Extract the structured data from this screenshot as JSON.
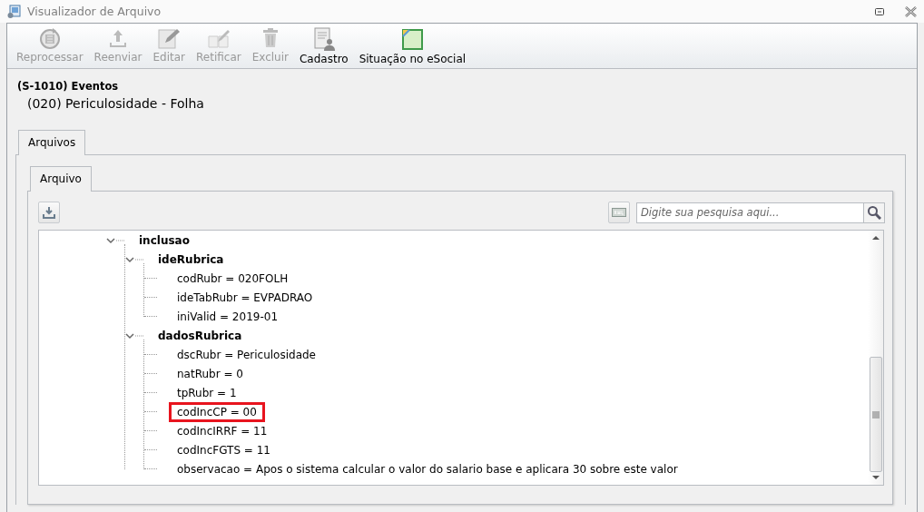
{
  "window": {
    "title": "Visualizador de Arquivo"
  },
  "toolbar": [
    {
      "label": "Reprocessar",
      "disabled": true
    },
    {
      "label": "Reenviar",
      "disabled": true
    },
    {
      "label": "Editar",
      "disabled": true
    },
    {
      "label": "Retificar",
      "disabled": true
    },
    {
      "label": "Excluir",
      "disabled": true
    },
    {
      "label": "Cadastro",
      "disabled": false
    },
    {
      "label": "Situação no eSocial",
      "disabled": false
    }
  ],
  "header": {
    "event": "(S-1010) Eventos",
    "subtitle": "(020) Periculosidade  - Folha"
  },
  "outer_tabs": [
    {
      "label": "Arquivos",
      "selected": true
    }
  ],
  "inner_tabs": [
    {
      "label": "Arquivo",
      "selected": true
    }
  ],
  "search": {
    "placeholder": "Digite sua pesquisa aqui..."
  },
  "tree": [
    {
      "label": "inclusao",
      "expanded": true,
      "children": [
        {
          "label": "ideRubrica",
          "expanded": true,
          "children": [
            {
              "label": "codRubr = 020FOLH",
              "highlighted": false
            },
            {
              "label": "ideTabRubr = EVPADRAO",
              "highlighted": false
            },
            {
              "label": "iniValid = 2019-01",
              "highlighted": false
            }
          ]
        },
        {
          "label": "dadosRubrica",
          "expanded": true,
          "children": [
            {
              "label": "dscRubr = Periculosidade",
              "highlighted": false
            },
            {
              "label": "natRubr = 0",
              "highlighted": false
            },
            {
              "label": "tpRubr = 1",
              "highlighted": false
            },
            {
              "label": "codIncCP = 00",
              "highlighted": true
            },
            {
              "label": "codIncIRRF = 11",
              "highlighted": false
            },
            {
              "label": "codIncFGTS = 11",
              "highlighted": false
            },
            {
              "label": "observacao = Apos o sistema calcular o valor do salario base  e aplicara 30 sobre este valor",
              "highlighted": false
            }
          ]
        }
      ]
    }
  ]
}
